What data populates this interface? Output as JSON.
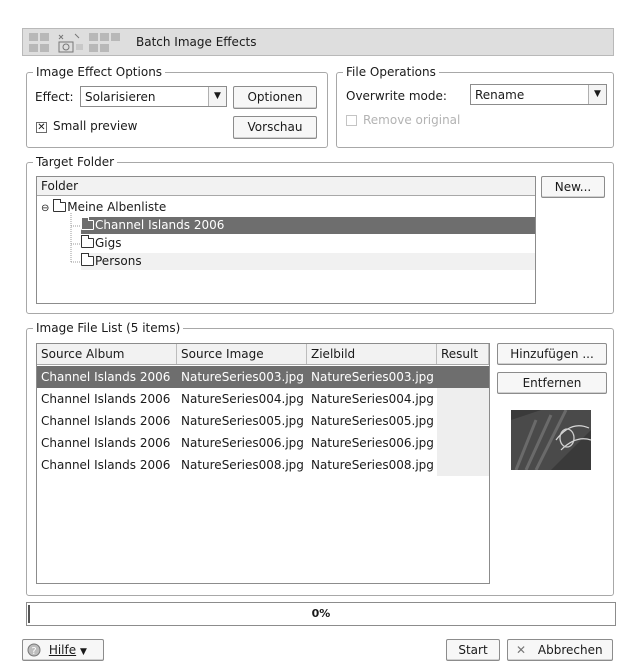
{
  "window": {
    "title": "Batch Image Effects"
  },
  "effect_options": {
    "legend": "Image Effect Options",
    "effect_label": "Effect:",
    "effect_value": "Solarisieren",
    "options_button": "Optionen",
    "small_preview_label": "Small preview",
    "small_preview_checked": true,
    "preview_button": "Vorschau"
  },
  "file_operations": {
    "legend": "File Operations",
    "overwrite_label": "Overwrite mode:",
    "overwrite_value": "Rename",
    "remove_original_label": "Remove original",
    "remove_original_checked": false
  },
  "target_folder": {
    "legend": "Target Folder",
    "column_header": "Folder",
    "new_button": "New...",
    "root": "Meine Albenliste",
    "items": [
      "Channel Islands 2006",
      "Gigs",
      "Persons"
    ],
    "selected": "Channel Islands 2006"
  },
  "image_list": {
    "legend": "Image File List (5 items)",
    "columns": [
      "Source Album",
      "Source Image",
      "Zielbild",
      "Result"
    ],
    "rows": [
      [
        "Channel Islands 2006",
        "NatureSeries003.jpg",
        "NatureSeries003.jpg",
        ""
      ],
      [
        "Channel Islands 2006",
        "NatureSeries004.jpg",
        "NatureSeries004.jpg",
        ""
      ],
      [
        "Channel Islands 2006",
        "NatureSeries005.jpg",
        "NatureSeries005.jpg",
        ""
      ],
      [
        "Channel Islands 2006",
        "NatureSeries006.jpg",
        "NatureSeries006.jpg",
        ""
      ],
      [
        "Channel Islands 2006",
        "NatureSeries008.jpg",
        "NatureSeries008.jpg",
        ""
      ]
    ],
    "selected_row": 0,
    "add_button": "Hinzufügen ...",
    "remove_button": "Entfernen"
  },
  "progress": {
    "value": 0,
    "text": "0%"
  },
  "footer": {
    "help_button": "Hilfe",
    "start_button": "Start",
    "cancel_button": "Abbrechen"
  },
  "icons": {
    "help": "help-icon",
    "cancel": "cancel-x-icon",
    "dropdown": "chevron-down-icon",
    "folder": "folder-icon",
    "collapse": "tree-collapse-icon"
  }
}
